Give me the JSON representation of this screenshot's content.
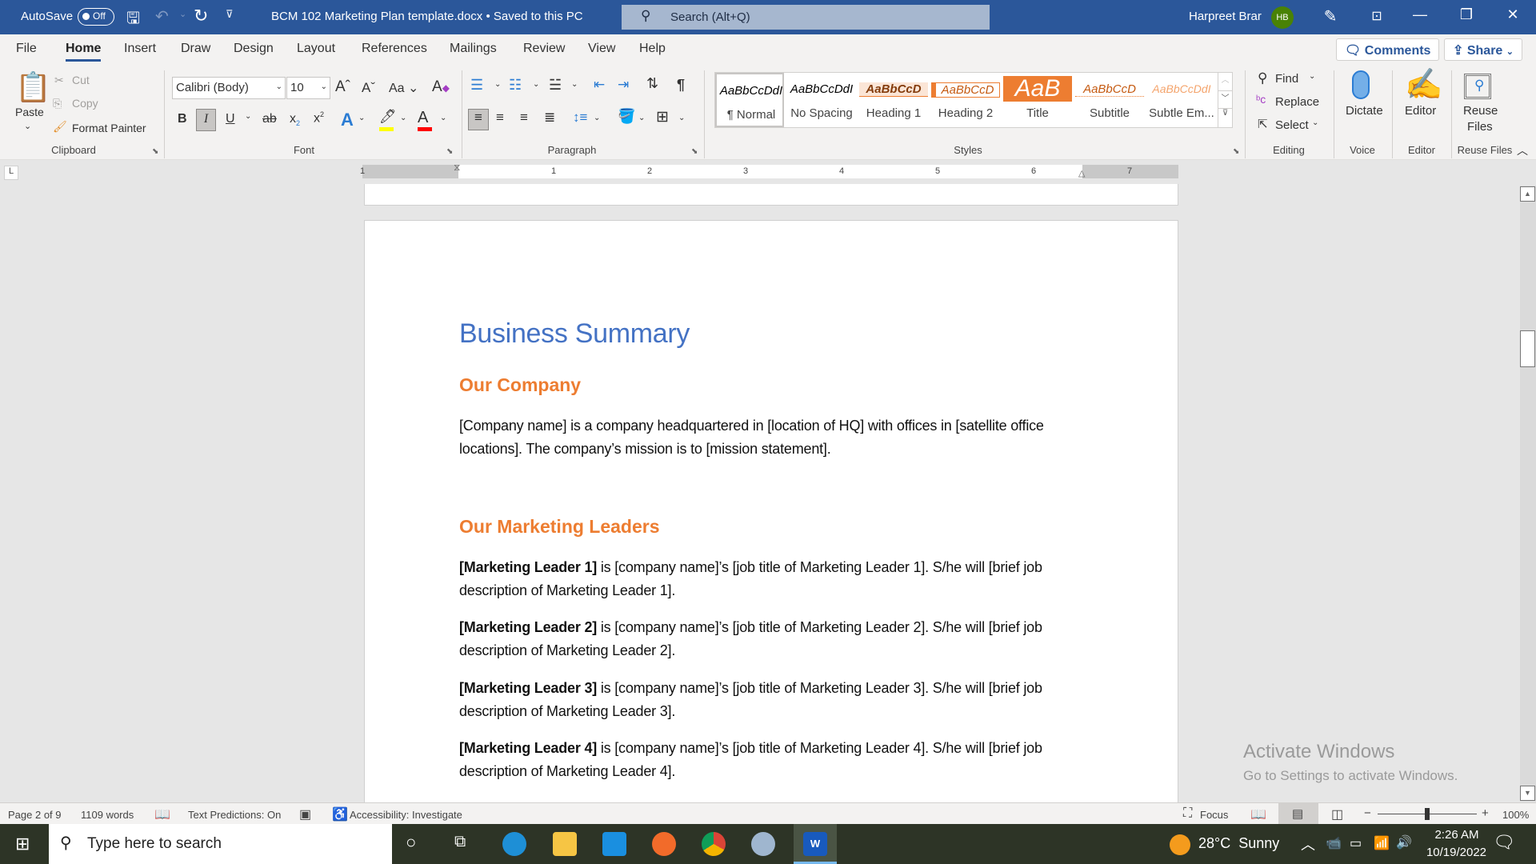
{
  "titlebar": {
    "autosave_label": "AutoSave",
    "autosave_state": "Off",
    "doc_title": "BCM 102 Marketing Plan template.docx • Saved to this PC",
    "search_placeholder": "Search (Alt+Q)",
    "user_name": "Harpreet Brar",
    "user_initials": "HB",
    "icons": [
      "save-icon",
      "undo-icon",
      "redo-icon",
      "customize-quick-access-icon",
      "pen-icon",
      "ribbon-display-icon",
      "minimize-icon",
      "restore-icon",
      "close-icon"
    ]
  },
  "tabs": [
    "File",
    "Home",
    "Insert",
    "Draw",
    "Design",
    "Layout",
    "References",
    "Mailings",
    "Review",
    "View",
    "Help"
  ],
  "active_tab": "Home",
  "actions": {
    "comments": "Comments",
    "share": "Share"
  },
  "ribbon": {
    "clipboard": {
      "label": "Clipboard",
      "paste": "Paste",
      "cut": "Cut",
      "copy": "Copy",
      "format_painter": "Format Painter"
    },
    "font": {
      "label": "Font",
      "font_name": "Calibri (Body)",
      "font_size": "10",
      "change_case": "Aa",
      "highlight_color": "#ffff00",
      "font_color": "#ff0000"
    },
    "paragraph": {
      "label": "Paragraph"
    },
    "styles": {
      "label": "Styles",
      "items": [
        {
          "preview": "AaBbCcDdI",
          "name": "¶ Normal"
        },
        {
          "preview": "AaBbCcDdI",
          "name": "No Spacing"
        },
        {
          "preview": "AaBbCcD",
          "name": "Heading 1"
        },
        {
          "preview": "AaBbCcD",
          "name": "Heading 2"
        },
        {
          "preview": "AaB",
          "name": "Title"
        },
        {
          "preview": "AaBbCcD",
          "name": "Subtitle"
        },
        {
          "preview": "AaBbCcDdI",
          "name": "Subtle Em..."
        }
      ]
    },
    "editing": {
      "label": "Editing",
      "find": "Find",
      "replace": "Replace",
      "select": "Select"
    },
    "voice": {
      "label": "Voice",
      "dictate": "Dictate"
    },
    "editor": {
      "label": "Editor",
      "editor": "Editor"
    },
    "reuse": {
      "label": "Reuse Files",
      "button_line1": "Reuse",
      "button_line2": "Files"
    }
  },
  "ruler": {
    "numbers": [
      "1",
      "1",
      "2",
      "3",
      "4",
      "5",
      "6",
      "7"
    ]
  },
  "document": {
    "title": "Business Summary",
    "sections": [
      {
        "heading": "Our Company",
        "lines": [
          "[Company name] is a company headquartered in [location of HQ] with offices in [satellite office",
          "locations]. The company’s mission is to [mission statement]."
        ]
      },
      {
        "heading": "Our Marketing Leaders"
      }
    ],
    "leaders": [
      {
        "bold": "[Marketing Leader 1]",
        "rest": " is [company name]’s [job title of Marketing Leader 1]. S/he will [brief job",
        "line2": "description of Marketing Leader 1]."
      },
      {
        "bold": "[Marketing Leader 2]",
        "rest": " is [company name]’s [job title of Marketing Leader 2]. S/he will [brief job",
        "line2": "description of Marketing Leader 2]."
      },
      {
        "bold": "[Marketing Leader 3]",
        "rest": " is [company name]’s [job title of Marketing Leader 3]. S/he will [brief job",
        "line2": "description of Marketing Leader 3]."
      },
      {
        "bold": "[Marketing Leader 4]",
        "rest": " is [company name]’s [job title of Marketing Leader 4]. S/he will [brief job",
        "line2": "description of Marketing Leader 4]."
      }
    ]
  },
  "watermark": {
    "line1": "Activate Windows",
    "line2": "Go to Settings to activate Windows."
  },
  "status": {
    "page": "Page 2 of 9",
    "words": "1109 words",
    "text_predictions": "Text Predictions: On",
    "accessibility": "Accessibility: Investigate",
    "focus": "Focus",
    "zoom": "100%",
    "zoom_minus": "−",
    "zoom_plus": "+"
  },
  "taskbar": {
    "search_placeholder": "Type here to search",
    "apps": [
      "cortana",
      "task-view",
      "edge",
      "file-explorer",
      "mail",
      "firefox",
      "chrome",
      "safari",
      "word"
    ],
    "weather": "28°C  Sunny",
    "time": "2:26 AM",
    "date": "10/19/2022"
  },
  "colors": {
    "accent": "#2b579a",
    "heading_blue": "#4472c4",
    "heading_orange": "#ed7d31",
    "avatar": "#498205"
  }
}
